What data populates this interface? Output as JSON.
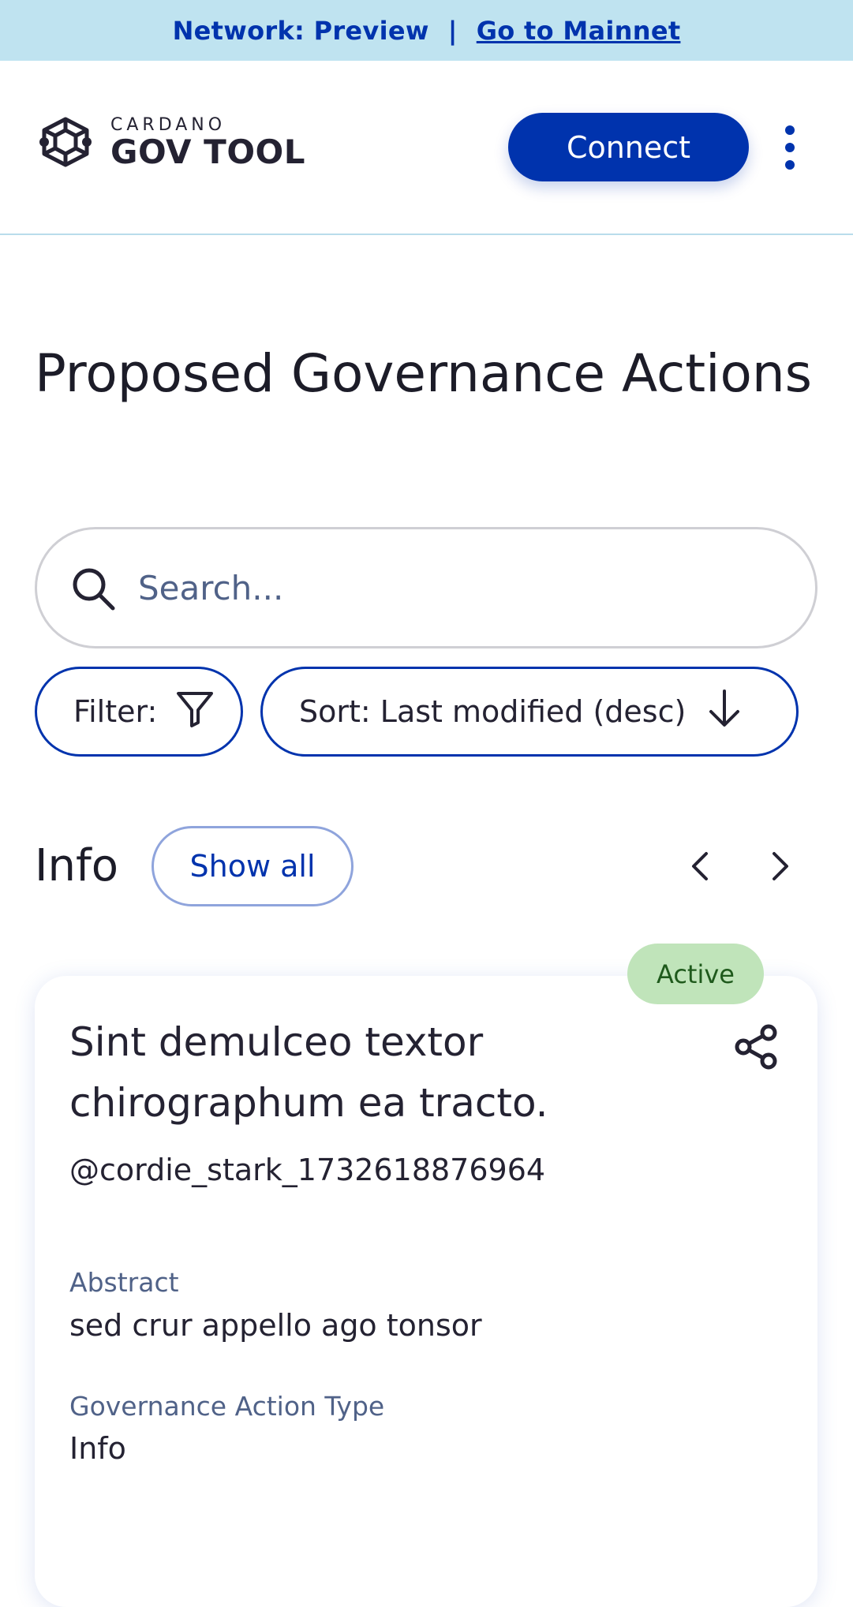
{
  "banner": {
    "network_text": "Network: Preview",
    "separator": "|",
    "mainnet_link": "Go to Mainnet"
  },
  "header": {
    "logo_small": "CARDANO",
    "logo_big": "GOV TOOL",
    "connect_label": "Connect"
  },
  "page": {
    "title": "Proposed Governance Actions"
  },
  "search": {
    "placeholder": "Search..."
  },
  "controls": {
    "filter_label": "Filter:",
    "sort_label": "Sort: Last modified (desc)"
  },
  "section": {
    "title": "Info",
    "show_all_label": "Show all"
  },
  "card": {
    "status": "Active",
    "title": "Sint demulceo textor chirographum ea tracto.",
    "author": "@cordie_stark_1732618876964",
    "abstract_label": "Abstract",
    "abstract_value": "sed crur appello ago tonsor",
    "type_label": "Governance Action Type",
    "type_value": "Info"
  },
  "colors": {
    "primary": "#0033ad",
    "banner_bg": "#bfe3f0",
    "badge_bg": "#c0e4ba",
    "label": "#506288"
  },
  "icons": {
    "logo": "cardano-hexagon-logo-icon",
    "menu": "kebab-menu-icon",
    "search": "search-icon",
    "filter": "filter-icon",
    "sort": "arrow-down-icon",
    "prev": "chevron-left-icon",
    "next": "chevron-right-icon",
    "share": "share-icon"
  }
}
